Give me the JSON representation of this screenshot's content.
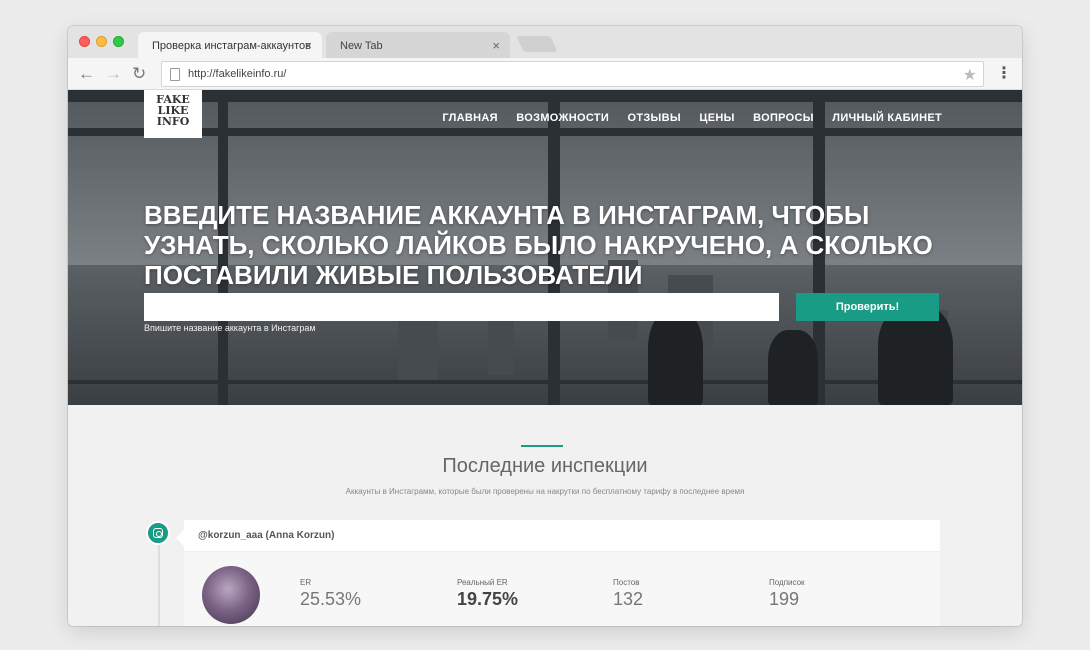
{
  "browser": {
    "tabs": [
      {
        "title": "Проверка инстаграм-аккаунтов",
        "active": true
      },
      {
        "title": "New Tab",
        "active": false
      }
    ],
    "url": "http://fakelikeinfo.ru/"
  },
  "site": {
    "logo_lines": [
      "FAKE",
      "LIKE",
      "INFO"
    ],
    "nav": [
      "ГЛАВНАЯ",
      "ВОЗМОЖНОСТИ",
      "ОТЗЫВЫ",
      "ЦЕНЫ",
      "ВОПРОСЫ",
      "ЛИЧНЫЙ КАБИНЕТ"
    ],
    "headline": "Введите название аккаунта в Инстаграм, чтобы узнать, сколько лайков было накручено, а сколько поставили живые пользователи",
    "search": {
      "value": "",
      "placeholder": "",
      "hint": "Впишите название аккаунта в Инстаграм",
      "button": "Проверить!"
    },
    "section": {
      "title": "Последние инспекции",
      "subtitle": "Аккаунты в Инстаграмм, которые были проверены на накрутки по бесплатному тарифу в последнее время"
    },
    "inspection": {
      "handle": "@korzun_aaa (Anna Korzun)",
      "stats": [
        {
          "label": "ER",
          "value": "25.53%"
        },
        {
          "label": "Реальный ER",
          "value": "19.75%"
        },
        {
          "label": "Постов",
          "value": "132"
        },
        {
          "label": "Подписок",
          "value": "199"
        }
      ]
    }
  },
  "colors": {
    "accent": "#199c86"
  },
  "icons": {
    "timeline": "instagram-icon"
  }
}
